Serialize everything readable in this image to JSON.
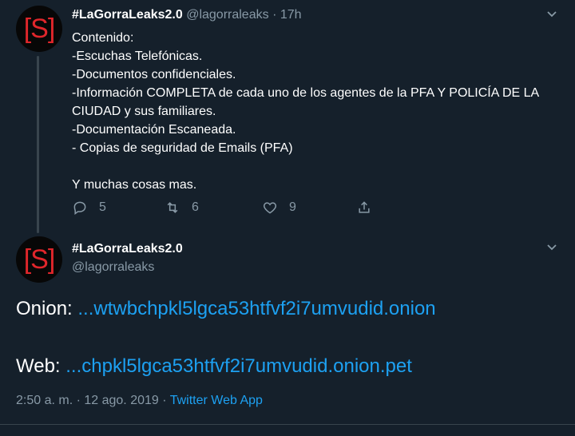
{
  "tweet1": {
    "avatar_text": "[S]",
    "display_name": "#LaGorraLeaks2.0",
    "handle": "@lagorraleaks",
    "separator": "·",
    "time": "17h",
    "lines": [
      "Contenido:",
      "-Escuchas Telefónicas.",
      "-Documentos confidenciales.",
      "-Información COMPLETA de cada uno de los agentes de la PFA Y POLICÍA DE LA CIUDAD y sus familiares.",
      "-Documentación Escaneada.",
      "- Copias de seguridad de Emails (PFA)",
      "",
      "Y muchas cosas mas."
    ],
    "reply_count": "5",
    "retweet_count": "6",
    "like_count": "9"
  },
  "tweet2": {
    "avatar_text": "[S]",
    "display_name": "#LaGorraLeaks2.0",
    "handle": "@lagorraleaks",
    "onion_label": "Onion:",
    "onion_link": "...wtwbchpkl5lgca53htfvf2i7umvudid.onion",
    "web_label": "Web:",
    "web_link": "...chpkl5lgca53htfvf2i7umvudid.onion.pet",
    "timestamp": "2:50 a. m. · 12 ago. 2019 ·",
    "source_app": "Twitter Web App"
  },
  "colors": {
    "background": "#15202b",
    "link": "#1da1f2",
    "muted": "#8899a6",
    "avatar_red": "#e0262b"
  },
  "icons": [
    "reply-icon",
    "retweet-icon",
    "like-icon",
    "share-icon",
    "chevron-down-icon"
  ]
}
